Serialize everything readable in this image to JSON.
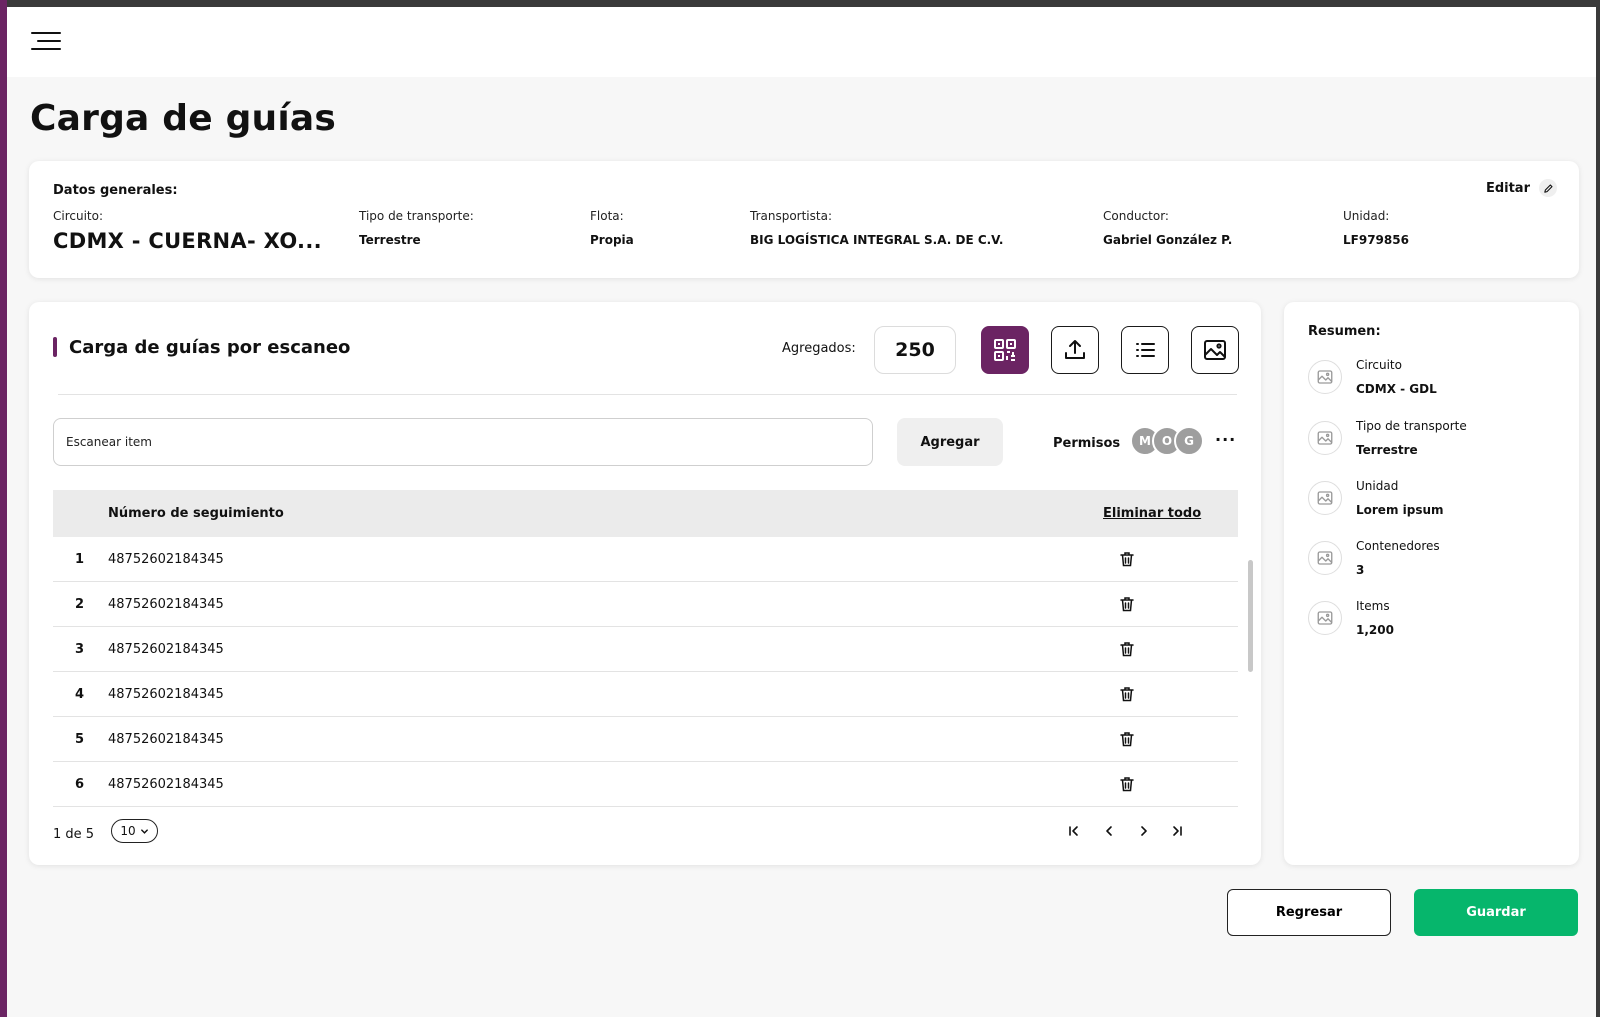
{
  "page": {
    "title": "Carga de guías"
  },
  "header": {
    "menu_icon": "menu-icon"
  },
  "general": {
    "title": "Datos generales:",
    "edit_label": "Editar",
    "fields": [
      {
        "label": "Circuito:",
        "value": "CDMX - CUERNA- XO..."
      },
      {
        "label": "Tipo de transporte:",
        "value": "Terrestre"
      },
      {
        "label": "Flota:",
        "value": "Propia"
      },
      {
        "label": "Transportista:",
        "value": "BIG LOGÍSTICA INTEGRAL S.A. DE C.V."
      },
      {
        "label": "Conductor:",
        "value": "Gabriel González P."
      },
      {
        "label": "Unidad:",
        "value": "LF979856"
      }
    ]
  },
  "scan": {
    "title": "Carga de guías por escaneo",
    "added_label": "Agregados:",
    "added_count": "250",
    "tools": [
      "qr-code-icon",
      "upload-icon",
      "list-icon",
      "image-icon"
    ],
    "input_placeholder": "Escanear item",
    "add_label": "Agregar",
    "permissions_label": "Permisos",
    "avatars": [
      "M",
      "O",
      "G"
    ],
    "more_label": "···",
    "table": {
      "column": "Número de seguimiento",
      "delete_all": "Eliminar todo",
      "rows": [
        {
          "num": "1",
          "tracking": "48752602184345"
        },
        {
          "num": "2",
          "tracking": "48752602184345"
        },
        {
          "num": "3",
          "tracking": "48752602184345"
        },
        {
          "num": "4",
          "tracking": "48752602184345"
        },
        {
          "num": "5",
          "tracking": "48752602184345"
        },
        {
          "num": "6",
          "tracking": "48752602184345"
        }
      ]
    },
    "pager": {
      "label": "1 de 5",
      "page_size": "10"
    }
  },
  "summary": {
    "title": "Resumen:",
    "items": [
      {
        "label": "Circuito",
        "value": "CDMX - GDL"
      },
      {
        "label": "Tipo de transporte",
        "value": "Terrestre"
      },
      {
        "label": "Unidad",
        "value": "Lorem ipsum"
      },
      {
        "label": "Contenedores",
        "value": "3"
      },
      {
        "label": "Items",
        "value": "1,200"
      }
    ]
  },
  "actions": {
    "back_label": "Regresar",
    "save_label": "Guardar"
  },
  "colors": {
    "accent": "#6b2463",
    "save": "#06b66c"
  }
}
